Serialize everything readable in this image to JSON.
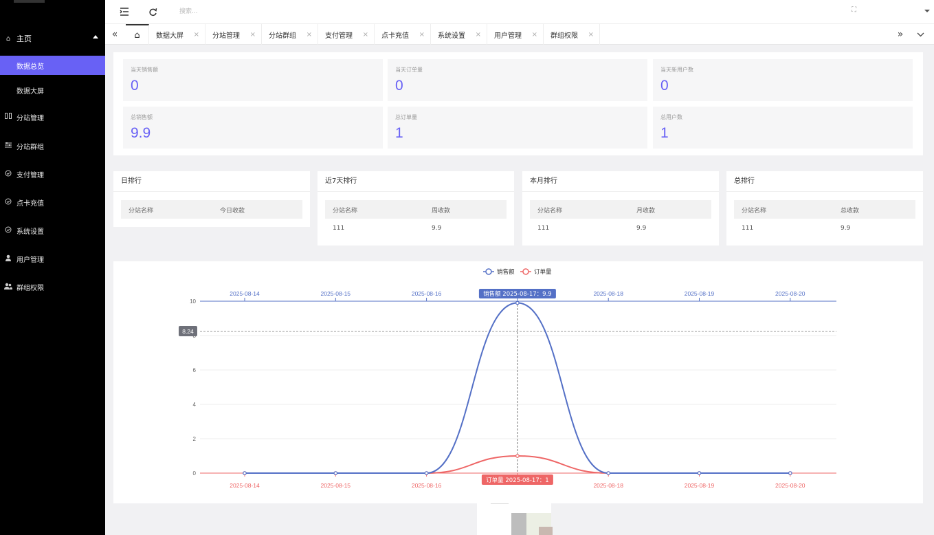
{
  "sidebar": {
    "home_label": "主页",
    "items": [
      {
        "label": "数据总览",
        "icon": "dashboard",
        "active": true,
        "sub": true
      },
      {
        "label": "数据大屏",
        "icon": "screen",
        "active": false,
        "sub": true
      },
      {
        "label": "分站管理",
        "icon": "columns-icon",
        "active": false,
        "sub": false
      },
      {
        "label": "分站群组",
        "icon": "sliders-icon",
        "active": false,
        "sub": false
      },
      {
        "label": "支付管理",
        "icon": "shield-icon",
        "active": false,
        "sub": false
      },
      {
        "label": "点卡充值",
        "icon": "shield-icon",
        "active": false,
        "sub": false
      },
      {
        "label": "系统设置",
        "icon": "shield-icon",
        "active": false,
        "sub": false
      },
      {
        "label": "用户管理",
        "icon": "user-icon",
        "active": false,
        "sub": false
      },
      {
        "label": "群组权限",
        "icon": "users-icon",
        "active": false,
        "sub": false
      }
    ]
  },
  "header": {
    "search_placeholder": "搜索..."
  },
  "tabs": [
    "数据大屏",
    "分站管理",
    "分站群组",
    "支付管理",
    "点卡充值",
    "系统设置",
    "用户管理",
    "群组权限"
  ],
  "stats": [
    {
      "label": "当天销售额",
      "value": "0"
    },
    {
      "label": "当天订单量",
      "value": "0"
    },
    {
      "label": "当天新用户数",
      "value": "0"
    },
    {
      "label": "总销售额",
      "value": "9.9"
    },
    {
      "label": "总订单量",
      "value": "1"
    },
    {
      "label": "总用户数",
      "value": "1"
    }
  ],
  "rankings": [
    {
      "title": "日排行",
      "col1": "分站名称",
      "col2": "今日收款",
      "rows": []
    },
    {
      "title": "近7天排行",
      "col1": "分站名称",
      "col2": "周收款",
      "rows": [
        {
          "name": "111",
          "amount": "9.9"
        }
      ]
    },
    {
      "title": "本月排行",
      "col1": "分站名称",
      "col2": "月收款",
      "rows": [
        {
          "name": "111",
          "amount": "9.9"
        }
      ]
    },
    {
      "title": "总排行",
      "col1": "分站名称",
      "col2": "总收款",
      "rows": [
        {
          "name": "111",
          "amount": "9.9"
        }
      ]
    }
  ],
  "chart_data": {
    "type": "line",
    "categories": [
      "2025-08-14",
      "2025-08-15",
      "2025-08-16",
      "2025-08-17",
      "2025-08-18",
      "2025-08-19",
      "2025-08-20"
    ],
    "series": [
      {
        "name": "销售额",
        "values": [
          0,
          0,
          0,
          9.9,
          0,
          0,
          0
        ],
        "color": "#5470c6"
      },
      {
        "name": "订单量",
        "values": [
          0,
          0,
          0,
          1,
          0,
          0,
          0
        ],
        "color": "#ee6666"
      }
    ],
    "ylim": [
      0,
      10
    ],
    "yticks": [
      0,
      2,
      4,
      6,
      8,
      10
    ],
    "smooth": true,
    "legend_position": "top-center",
    "grid": true,
    "tooltip": {
      "sales_label": "销售额  2025-08-17：9.9",
      "orders_label": "订单量  2025-08-17：1",
      "crosshair_y_value": "8.24"
    }
  }
}
